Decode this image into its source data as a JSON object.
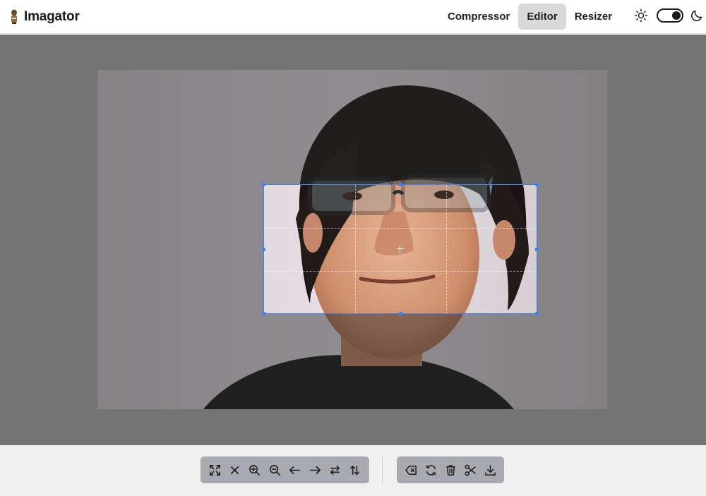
{
  "app": {
    "name": "Imagator"
  },
  "nav": {
    "items": [
      {
        "label": "Compressor",
        "active": false
      },
      {
        "label": "Editor",
        "active": true
      },
      {
        "label": "Resizer",
        "active": false
      }
    ]
  },
  "theme": {
    "light_icon": "sun-icon",
    "dark_icon": "moon-icon",
    "toggle_state": "dark"
  },
  "editor": {
    "crop_box_visible": true,
    "colors": {
      "workspace_bg": "#747474",
      "crop_border": "#3b82f6",
      "toolbar_group_bg": "#a9aab0",
      "active_nav_bg": "#d9d9d9"
    }
  },
  "toolbar": {
    "view_tools": [
      "fit-to-screen-icon",
      "close-icon",
      "zoom-in-icon",
      "zoom-out-icon",
      "move-left-icon",
      "move-right-icon",
      "flip-horizontal-icon",
      "flip-vertical-icon"
    ],
    "edit_tools": [
      "clear-icon",
      "reset-icon",
      "delete-icon",
      "crop-cut-icon",
      "download-icon"
    ]
  }
}
